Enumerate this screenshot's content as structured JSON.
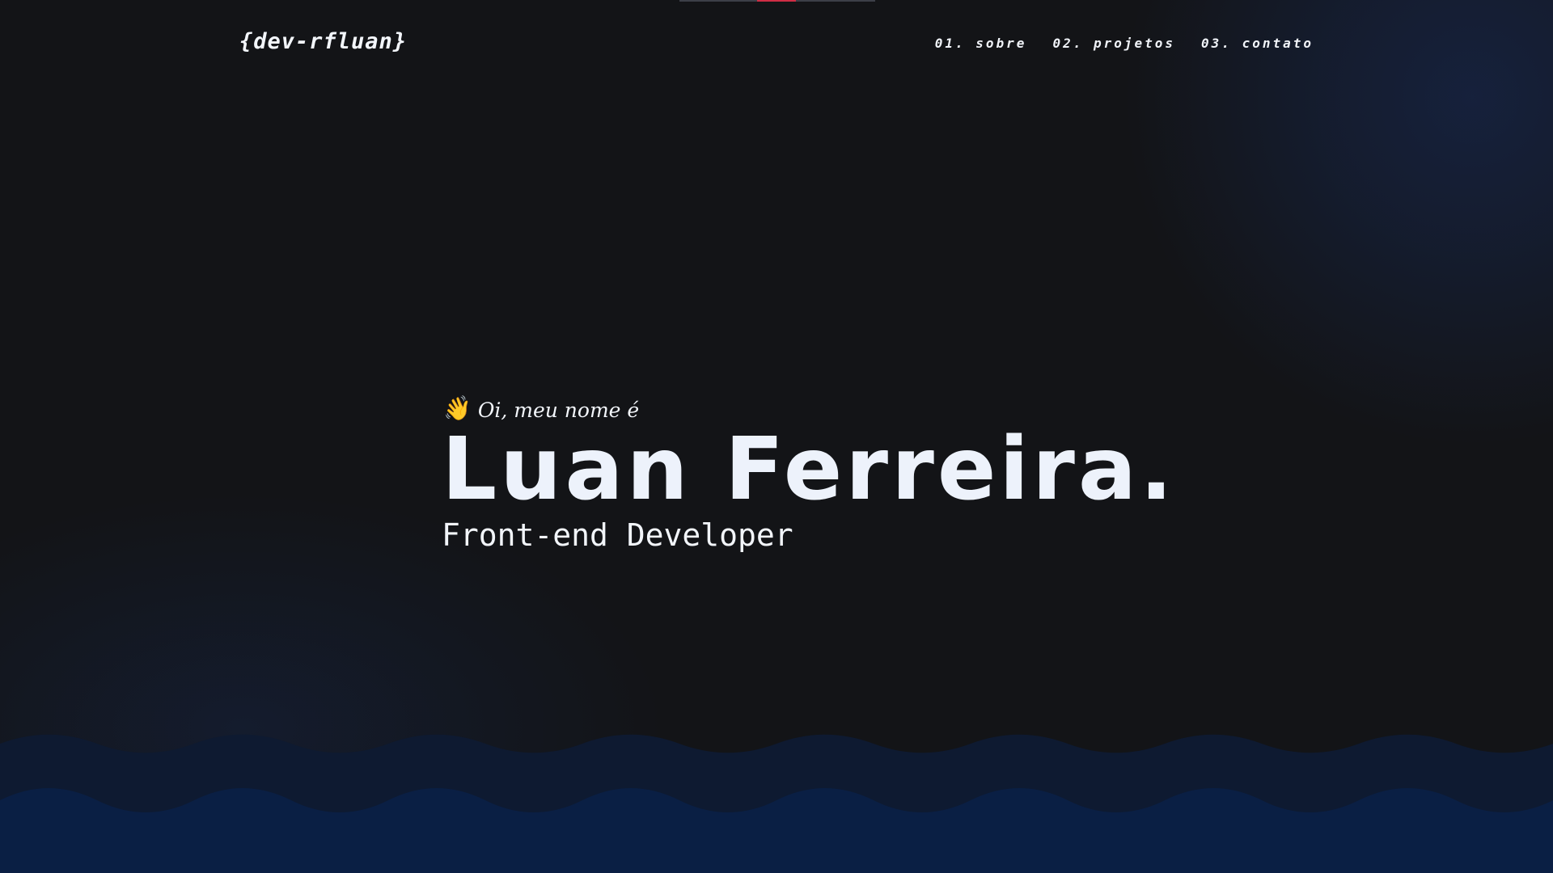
{
  "header": {
    "logo": "{dev-rfluan}",
    "nav": [
      {
        "label": "01. sobre"
      },
      {
        "label": "02. projetos"
      },
      {
        "label": "03. contato"
      }
    ]
  },
  "hero": {
    "greeting_icon": "waving-hand-icon",
    "greeting": "Oi, meu nome é",
    "name": "Luan Ferreira.",
    "role": "Front-end Developer"
  },
  "colors": {
    "background": "#131417",
    "text": "#edf2fb",
    "accent": "#cf2d45",
    "wave_dark": "#0f1a30",
    "wave_light": "#0a1f45"
  }
}
